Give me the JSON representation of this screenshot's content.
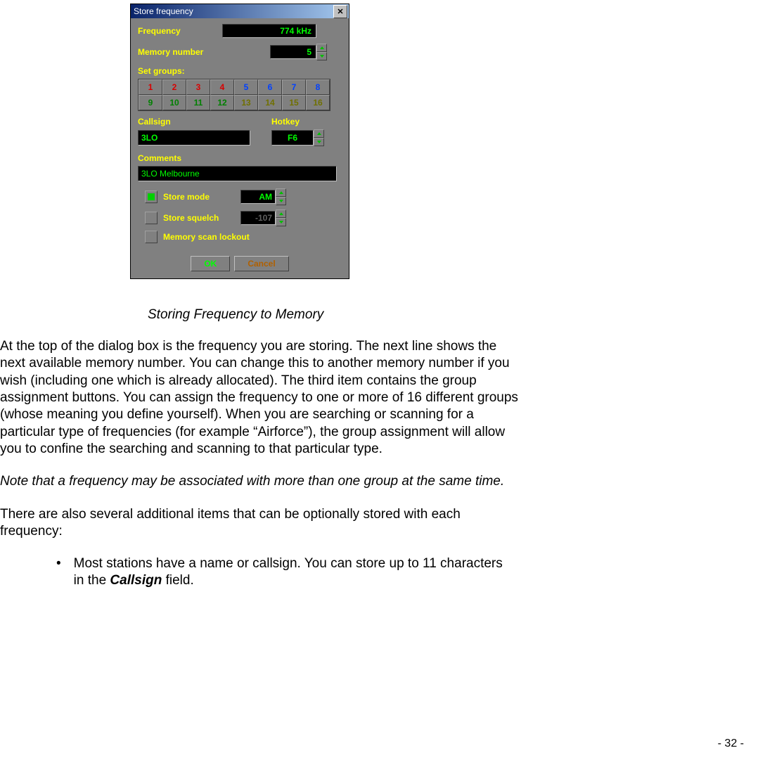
{
  "dialog": {
    "title": "Store frequency",
    "close_glyph": "✕",
    "frequency_label": "Frequency",
    "frequency_value": "774 kHz",
    "memory_label": "Memory number",
    "memory_value": "5",
    "groups_label": "Set groups:",
    "groups_row1": [
      "1",
      "2",
      "3",
      "4",
      "5",
      "6",
      "7",
      "8"
    ],
    "groups_row1_cls": [
      "red",
      "red",
      "red",
      "red",
      "blue",
      "blue",
      "blue",
      "blue"
    ],
    "groups_row2": [
      "9",
      "10",
      "11",
      "12",
      "13",
      "14",
      "15",
      "16"
    ],
    "groups_row2_cls": [
      "green",
      "green",
      "green",
      "green",
      "olive",
      "olive",
      "olive",
      "olive"
    ],
    "callsign_label": "Callsign",
    "hotkey_label": "Hotkey",
    "callsign_value": "3LO",
    "hotkey_value": "F6",
    "comments_label": "Comments",
    "comments_value": "3LO Melbourne",
    "store_mode_label": "Store mode",
    "store_mode_value": "AM",
    "store_squelch_label": "Store squelch",
    "store_squelch_value": "-107",
    "lockout_label": "Memory scan lockout",
    "ok_label": "OK",
    "cancel_label": "Cancel"
  },
  "caption": "Storing Frequency to Memory",
  "para1": "At the top of the dialog box is the frequency you are storing. The next line shows the next available memory number. You can change this to another memory number if you wish (including one which is already allocated). The third item contains the group assignment buttons. You can assign the frequency to one or more of 16 different groups (whose meaning you define yourself).  When you are searching or scanning for a particular type of frequencies (for example “Airforce”), the group assignment will allow you to confine the searching and scanning to that particular type.",
  "para2": "Note that a frequency may be associated with more than one group at the same time.",
  "para3": "There are also several additional items that can be optionally stored with each frequency:",
  "bullet1_a": "Most stations have a name or callsign.  You can store up to 11 characters in the ",
  "bullet1_b": "Callsign",
  "bullet1_c": " field.",
  "page_num": "- 32 -"
}
